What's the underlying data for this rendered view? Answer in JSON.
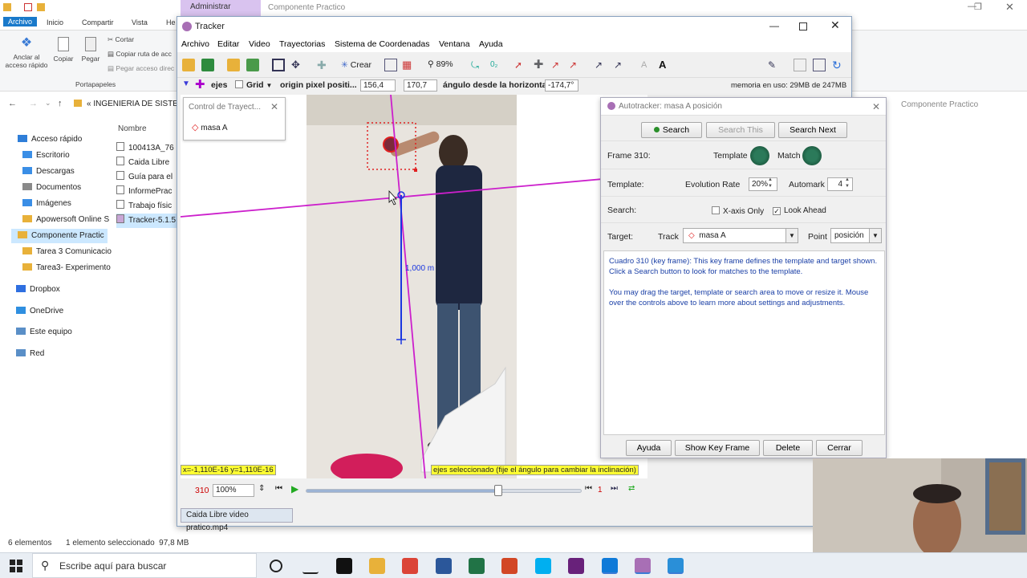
{
  "explorer": {
    "title_context": "Administrar",
    "title_path": "Componente Practico",
    "tabs": [
      "Archivo",
      "Inicio",
      "Compartir",
      "Vista",
      "He"
    ],
    "ribbon": {
      "pin_label": "Anclar al acceso rápido",
      "copy_label": "Copiar",
      "paste_label": "Pegar",
      "cut_label": "Cortar",
      "copy_path_label": "Copiar ruta de acc",
      "paste_shortcut_label": "Pegar acceso direc",
      "group_label": "Portapapeles"
    },
    "address": "« INGENIERIA DE SISTEM",
    "search_placeholder": "Componente Practico",
    "column_name": "Nombre",
    "nav_items": [
      {
        "label": "Acceso rápido",
        "color": "#2f7ed8"
      },
      {
        "label": "Escritorio",
        "color": "#3a8ee6"
      },
      {
        "label": "Descargas",
        "color": "#3a8ee6"
      },
      {
        "label": "Documentos",
        "color": "#8a8a8a"
      },
      {
        "label": "Imágenes",
        "color": "#3a8ee6"
      },
      {
        "label": "Apowersoft Online S",
        "color": "#e8b13a"
      },
      {
        "label": "Componente Practic",
        "color": "#e8b13a"
      },
      {
        "label": "Tarea 3 Comunicacio",
        "color": "#e8b13a"
      },
      {
        "label": "Tarea3- Experimento",
        "color": "#e8b13a"
      },
      {
        "label": "Dropbox",
        "color": "#2f6fe0"
      },
      {
        "label": "OneDrive",
        "color": "#2f8fe0"
      },
      {
        "label": "Este equipo",
        "color": "#5a8fc7"
      },
      {
        "label": "Red",
        "color": "#5a8fc7"
      }
    ],
    "files": [
      "100413A_76",
      "Caida Libre",
      "Guía para el",
      "InformePrac",
      "Trabajo físic",
      "Tracker-5.1.5"
    ],
    "status_count": "6 elementos",
    "status_selected": "1 elemento seleccionado  97,8 MB"
  },
  "tracker": {
    "title": "Tracker",
    "menu": [
      "Archivo",
      "Editar",
      "Video",
      "Trayectorias",
      "Sistema de Coordenadas",
      "Ventana",
      "Ayuda"
    ],
    "toolbar": {
      "create_label": "Crear",
      "zoom": "89%"
    },
    "axes_bar": {
      "axes_label": "ejes",
      "grid_label": "Grid",
      "origin_label": "origin pixel positi...",
      "origin_x": "156,4",
      "origin_y": "170,7",
      "angle_label": "ángulo desde la horizontal",
      "angle_value": "-174,7°",
      "memory": "memoria en uso: 29MB de 247MB"
    },
    "canvas": {
      "distance_label": "1,000 m",
      "coord_readout": "x=-1,110E-16  y=1,110E-16",
      "hint": "ejes seleccionado (fije el ángulo para cambiar la inclinación)"
    },
    "player": {
      "frame": "310",
      "rate": "100%",
      "step": "1",
      "progress_fraction": 0.7
    },
    "video_tab": "Caida Libre video pratico.mp4"
  },
  "control_panel": {
    "title": "Control de Trayect...",
    "track": "masa A"
  },
  "autotracker": {
    "title": "Autotracker: masa A posición",
    "search_btn": "Search",
    "search_this_btn": "Search This",
    "search_next_btn": "Search Next",
    "frame_label": "Frame 310:",
    "template_label": "Template",
    "match_label": "Match",
    "template_row_label": "Template:",
    "evolution_label": "Evolution Rate",
    "evolution_value": "20%",
    "automark_label": "Automark",
    "automark_value": "4",
    "search_row_label": "Search:",
    "xaxis_only_label": "X-axis Only",
    "look_ahead_label": "Look Ahead",
    "target_label": "Target:",
    "track_label": "Track",
    "track_value": "masa A",
    "point_label": "Point",
    "point_value": "posición",
    "info_line1": "Cuadro 310 (key frame): This key frame defines the template and target shown. Click a Search button to look for matches to the template.",
    "info_line2": "You may drag the target, template or search area to move or resize it.  Mouse over the controls above to learn more about settings and adjustments.",
    "help_btn": "Ayuda",
    "show_key_btn": "Show Key Frame",
    "delete_btn": "Delete",
    "close_btn": "Cerrar"
  },
  "taskbar": {
    "search_placeholder": "Escribe aquí para buscar",
    "apps": [
      {
        "name": "cortana-icon",
        "color": "#222222"
      },
      {
        "name": "task-view-icon",
        "color": "#222222"
      },
      {
        "name": "notion-icon",
        "color": "#111111"
      },
      {
        "name": "file-explorer-icon",
        "color": "#e8b13a"
      },
      {
        "name": "chrome-icon",
        "color": "#db4437"
      },
      {
        "name": "word-icon",
        "color": "#2b579a"
      },
      {
        "name": "excel-icon",
        "color": "#217346"
      },
      {
        "name": "powerpoint-icon",
        "color": "#d24726"
      },
      {
        "name": "skype-icon",
        "color": "#00aff0"
      },
      {
        "name": "visual-studio-icon",
        "color": "#68217a"
      },
      {
        "name": "edge-icon",
        "color": "#0f7ad8"
      },
      {
        "name": "tracker-icon",
        "color": "#a86fb5"
      },
      {
        "name": "camera-app-icon",
        "color": "#2a8fd8"
      }
    ]
  }
}
